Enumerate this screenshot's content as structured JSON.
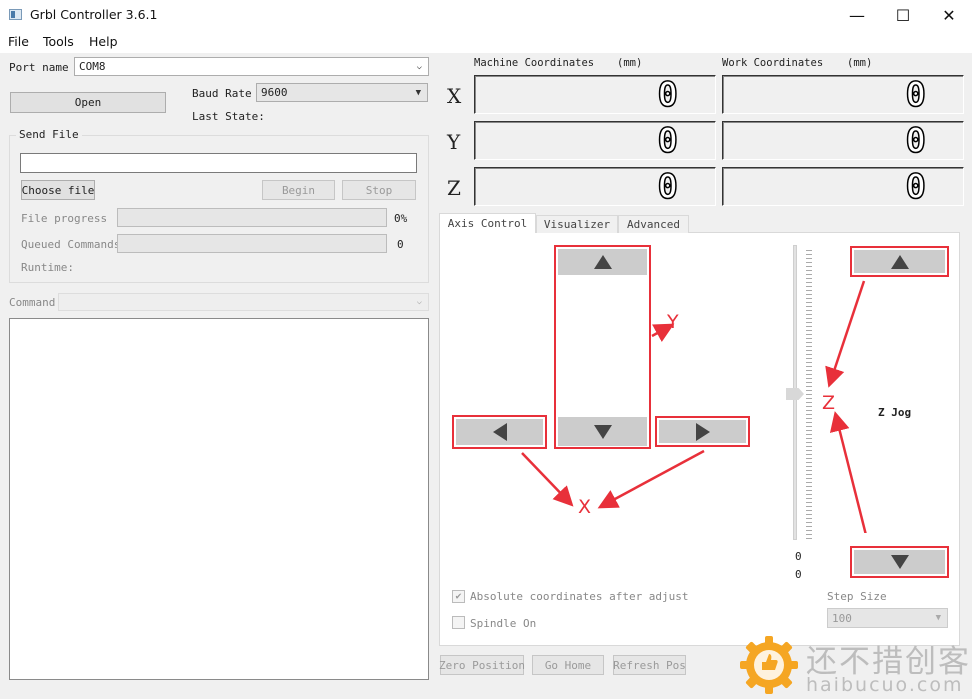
{
  "window": {
    "title": "Grbl Controller 3.6.1",
    "minimize": "—",
    "maximize": "☐",
    "close": "✕"
  },
  "menu": {
    "file": "File",
    "tools": "Tools",
    "help": "Help"
  },
  "connection": {
    "port_label": "Port name",
    "port_value": "COM8",
    "open_label": "Open",
    "baud_label": "Baud Rate",
    "baud_value": "9600",
    "last_state_label": "Last State:"
  },
  "send_file": {
    "group_label": "Send File",
    "file_path_value": "",
    "choose_label": "Choose file",
    "begin_label": "Begin",
    "stop_label": "Stop",
    "file_progress_label": "File progress",
    "file_progress_percent": "0%",
    "file_progress_fraction": 0,
    "queued_label": "Queued Commands",
    "queued_value": "0",
    "queued_fraction": 0,
    "runtime_label": "Runtime:"
  },
  "command": {
    "label": "Command",
    "value": ""
  },
  "coordinates": {
    "machine_header": "Machine Coordinates",
    "work_header": "Work Coordinates",
    "unit": "(mm)",
    "axes": [
      {
        "name": "X",
        "machine": "0",
        "work": "0"
      },
      {
        "name": "Y",
        "machine": "0",
        "work": "0"
      },
      {
        "name": "Z",
        "machine": "0",
        "work": "0"
      }
    ]
  },
  "tabs": [
    "Axis Control",
    "Visualizer",
    "Advanced"
  ],
  "axis_control": {
    "z_jog_label": "Z Jog",
    "slider_values": [
      "0",
      "0"
    ],
    "absolute_label": "Absolute coordinates after adjust",
    "absolute_checked": true,
    "spindle_label": "Spindle On",
    "spindle_checked": false,
    "step_size_label": "Step Size",
    "step_size_value": "100"
  },
  "annotations": {
    "y": "Y",
    "x": "X",
    "z": "Z",
    "color": "#e8303a"
  },
  "bottom_buttons": {
    "zero_position": "Zero Position",
    "go_home": "Go Home",
    "refresh_pos": "Refresh Pos"
  },
  "watermark": {
    "text": "还不措创客",
    "url": "haibucuo.com",
    "badge_color": "#f5a623"
  },
  "icons": [
    "app-icon",
    "up-arrow-icon",
    "down-arrow-icon",
    "left-arrow-icon",
    "right-arrow-icon",
    "dropdown-arrow-icon",
    "check-icon",
    "gear-badge-icon"
  ]
}
